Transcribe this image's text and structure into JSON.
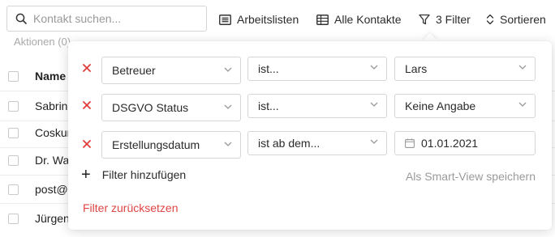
{
  "search": {
    "placeholder": "Kontakt suchen..."
  },
  "toolbar": {
    "worklists_label": "Arbeitslisten",
    "all_contacts_label": "Alle Kontakte",
    "filter_label": "3 Filter",
    "sort_label": "Sortieren"
  },
  "actions_label": "Aktionen (0)",
  "table": {
    "header": "Name",
    "rows": [
      "Sabrina",
      "Coskun",
      "Dr. Walter",
      "post@",
      "Jürgen"
    ]
  },
  "filters": [
    {
      "field": "Betreuer",
      "operator": "ist...",
      "value": "Lars",
      "value_type": "select"
    },
    {
      "field": "DSGVO Status",
      "operator": "ist...",
      "value": "Keine Angabe",
      "value_type": "select"
    },
    {
      "field": "Erstellungsdatum",
      "operator": "ist ab dem...",
      "value": "01.01.2021",
      "value_type": "date"
    }
  ],
  "add_filter_label": "Filter hinzufügen",
  "save_smart_view_label": "Als Smart-View speichern",
  "reset_filter_label": "Filter zurücksetzen",
  "colors": {
    "remove": "#e03c3c",
    "reset": "#e04545",
    "muted": "#9a9a9a"
  }
}
